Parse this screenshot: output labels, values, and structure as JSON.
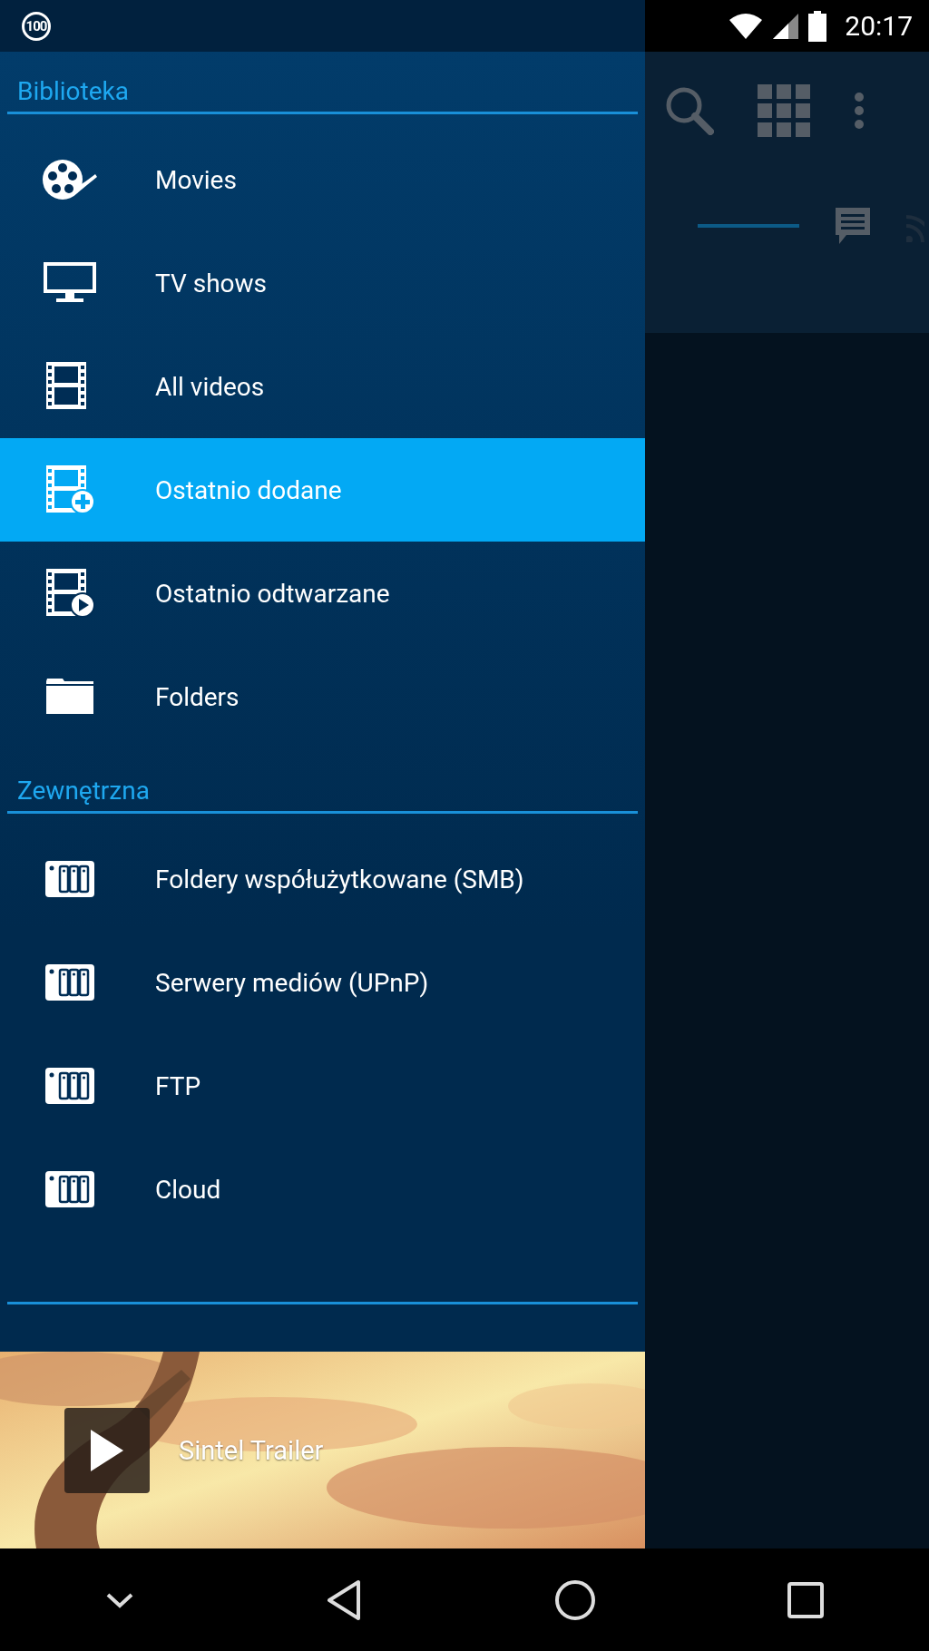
{
  "status_bar": {
    "badge": "100",
    "time": "20:17"
  },
  "drawer": {
    "sections": [
      {
        "header": "Biblioteka",
        "items": [
          {
            "label": "Movies",
            "kind": "reel",
            "selected": false
          },
          {
            "label": "TV shows",
            "kind": "tv",
            "selected": false
          },
          {
            "label": "All videos",
            "kind": "film",
            "selected": false
          },
          {
            "label": "Ostatnio dodane",
            "kind": "film-add",
            "selected": true
          },
          {
            "label": "Ostatnio odtwarzane",
            "kind": "film-play",
            "selected": false
          },
          {
            "label": "Folders",
            "kind": "folder",
            "selected": false
          }
        ]
      },
      {
        "header": "Zewnętrzna",
        "items": [
          {
            "label": "Foldery współużytkowane (SMB)",
            "kind": "nas",
            "selected": false
          },
          {
            "label": "Serwery mediów (UPnP)",
            "kind": "nas",
            "selected": false
          },
          {
            "label": "FTP",
            "kind": "nas",
            "selected": false
          },
          {
            "label": "Cloud",
            "kind": "nas",
            "selected": false
          }
        ]
      }
    ]
  },
  "mini_player": {
    "title": "Sintel Trailer",
    "kind": "picture"
  }
}
